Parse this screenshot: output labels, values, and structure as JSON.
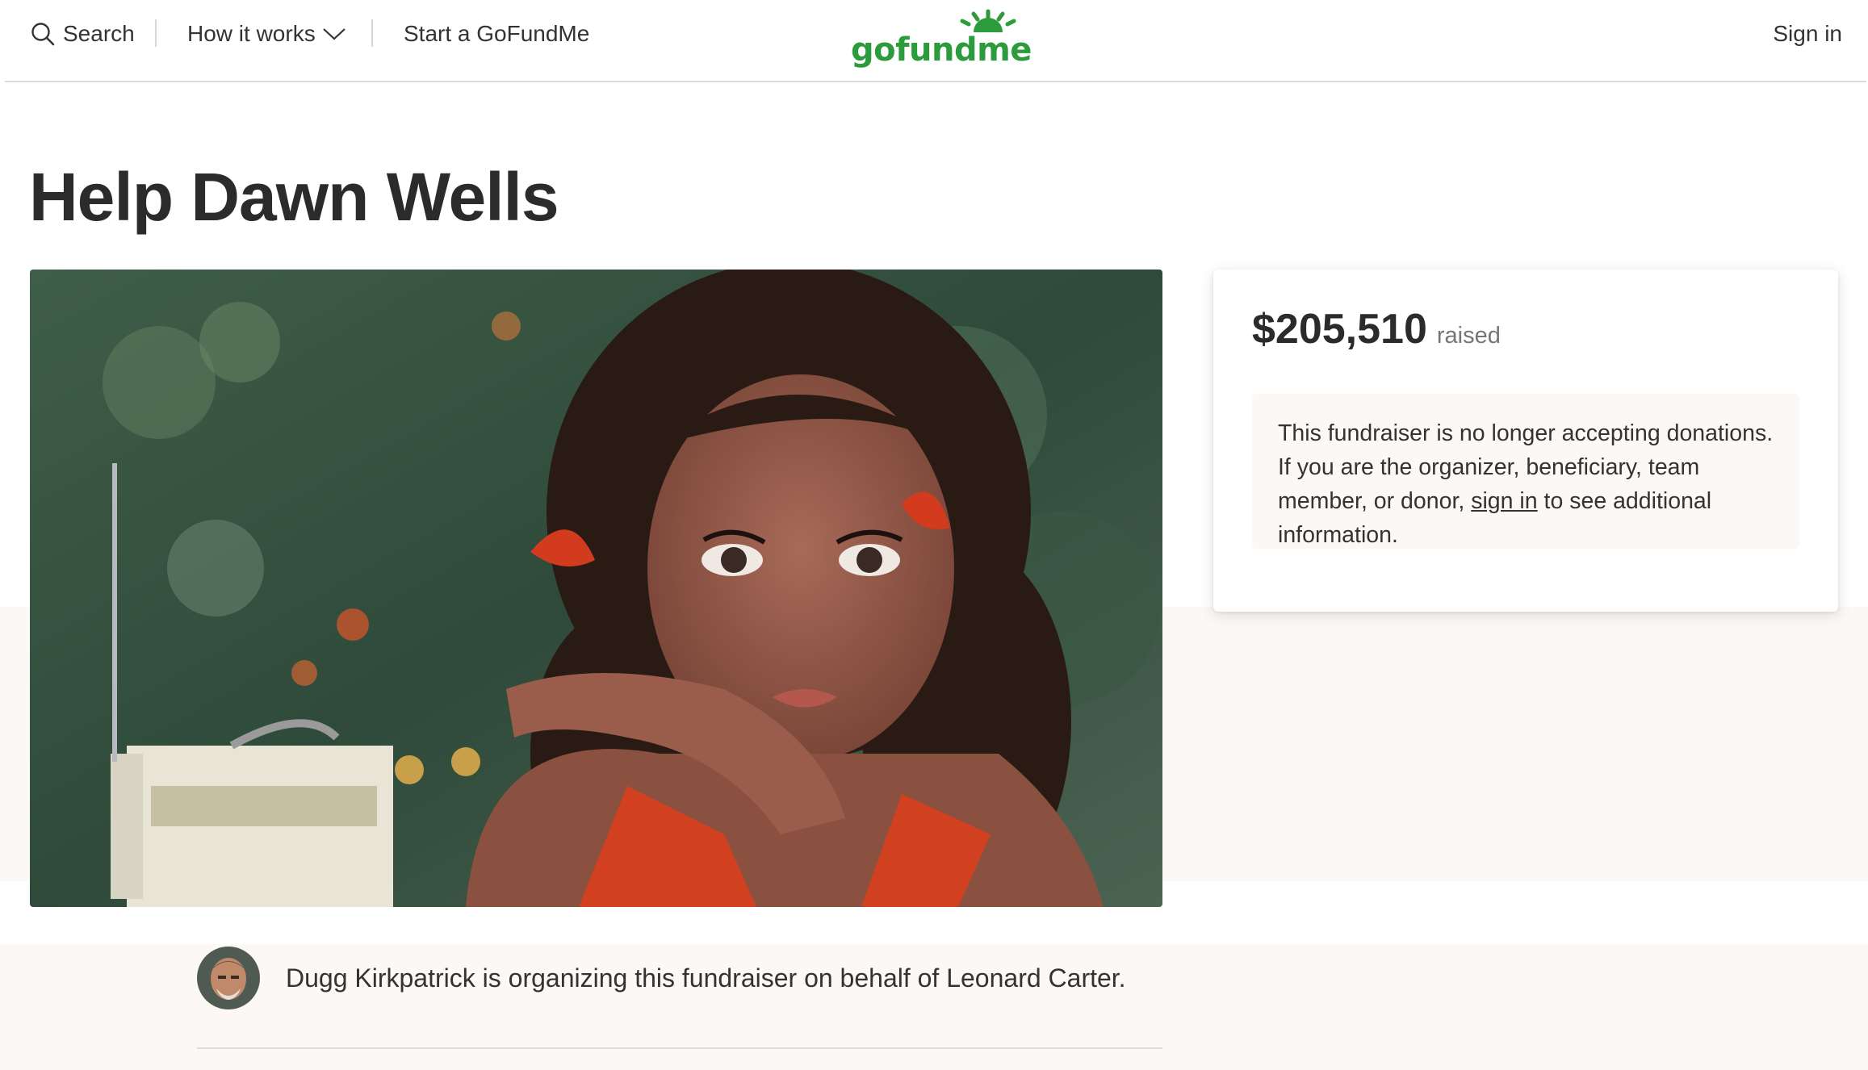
{
  "nav": {
    "search_label": "Search",
    "how_it_works_label": "How it works",
    "start_label": "Start a GoFundMe",
    "sign_in_label": "Sign in",
    "logo_text": "gofundme",
    "brand_color": "#2c9b3b"
  },
  "campaign": {
    "title": "Help Dawn Wells",
    "amount_raised": "$205,510",
    "raised_label": "raised",
    "notice_part1": "This fundraiser is no longer accepting donations. If you are the organizer, beneficiary, team member, or donor,",
    "notice_link": "sign in",
    "notice_part2": "to see additional information.",
    "organizer_text": "Dugg Kirkpatrick is organizing this fundraiser on behalf of Leonard Carter."
  },
  "icons": {
    "search": "search-icon",
    "chevron": "chevron-down-icon",
    "logo_sun": "sun-rays-icon"
  },
  "colors": {
    "band_bg": "#fbf8f6",
    "title_text": "#2b2b2b"
  }
}
